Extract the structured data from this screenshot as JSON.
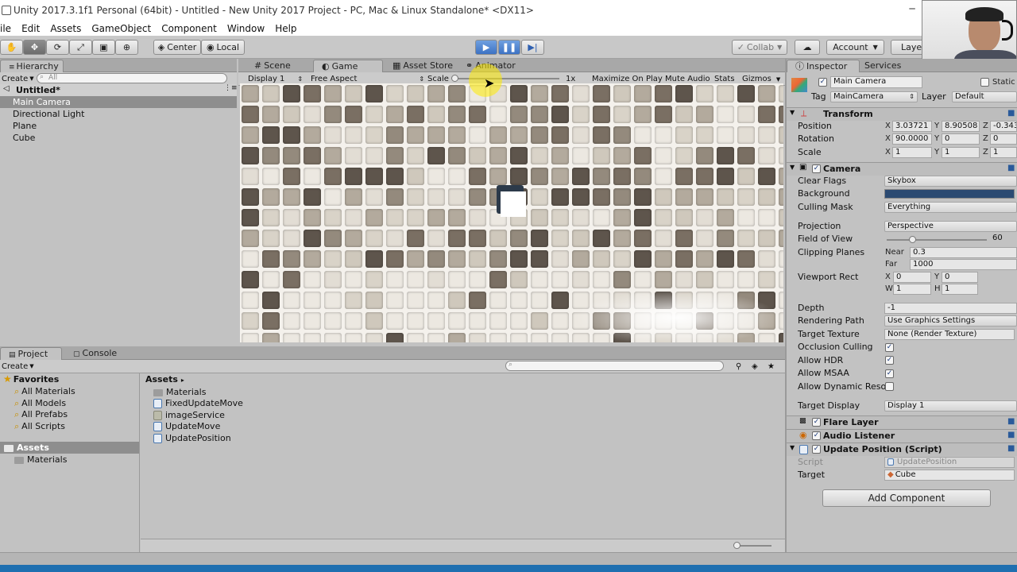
{
  "window": {
    "title": "Unity 2017.3.1f1 Personal (64bit) - Untitled - New Unity 2017 Project - PC, Mac & Linux Standalone* <DX11>"
  },
  "menu": [
    "ile",
    "Edit",
    "Assets",
    "GameObject",
    "Component",
    "Window",
    "Help"
  ],
  "toolbar": {
    "center_label": "Center",
    "local_label": "Local",
    "collab_label": "Collab",
    "account_label": "Account",
    "layers_label": "Laye"
  },
  "hierarchy": {
    "tab": "Hierarchy",
    "create": "Create",
    "search_placeholder": "All",
    "scene": "Untitled*",
    "items": [
      "Main Camera",
      "Directional Light",
      "Plane",
      "Cube"
    ]
  },
  "center_tabs": [
    "Scene",
    "Game",
    "Asset Store",
    "Animator"
  ],
  "game_bar": {
    "display": "Display 1",
    "aspect": "Free Aspect",
    "scale_label": "Scale",
    "scale_value": "1x",
    "maximize": "Maximize On Play",
    "mute": "Mute Audio",
    "stats": "Stats",
    "gizmos": "Gizmos"
  },
  "project": {
    "tab": "Project",
    "console_tab": "Console",
    "create": "Create",
    "favorites_label": "Favorites",
    "favorites": [
      "All Materials",
      "All Models",
      "All Prefabs",
      "All Scripts"
    ],
    "assets_root": "Assets",
    "assets_children": [
      "Materials"
    ],
    "breadcrumb": "Assets",
    "files": [
      {
        "name": "Materials",
        "kind": "folder"
      },
      {
        "name": "FixedUpdateMove",
        "kind": "script"
      },
      {
        "name": "imageService",
        "kind": "image"
      },
      {
        "name": "UpdateMove",
        "kind": "script"
      },
      {
        "name": "UpdatePosition",
        "kind": "script"
      }
    ]
  },
  "inspector": {
    "tab": "Inspector",
    "services_tab": "Services",
    "object_name": "Main Camera",
    "static_label": "Static",
    "tag_label": "Tag",
    "tag_value": "MainCamera",
    "layer_label": "Layer",
    "layer_value": "Default",
    "transform": {
      "title": "Transform",
      "position_label": "Position",
      "position": {
        "x": "3.03721",
        "y": "8.90508",
        "z": "-0.343"
      },
      "rotation_label": "Rotation",
      "rotation": {
        "x": "90.0000",
        "y": "0",
        "z": "0"
      },
      "scale_label": "Scale",
      "scale": {
        "x": "1",
        "y": "1",
        "z": "1"
      }
    },
    "camera": {
      "title": "Camera",
      "clear_flags_label": "Clear Flags",
      "clear_flags": "Skybox",
      "background_label": "Background",
      "background_color": "#2b4a72",
      "culling_mask_label": "Culling Mask",
      "culling_mask": "Everything",
      "projection_label": "Projection",
      "projection": "Perspective",
      "fov_label": "Field of View",
      "fov": "60",
      "fov_fraction": 0.25,
      "clipping_label": "Clipping Planes",
      "near_label": "Near",
      "near": "0.3",
      "far_label": "Far",
      "far": "1000",
      "viewport_label": "Viewport Rect",
      "vp_x": "0",
      "vp_y": "0",
      "vp_w": "1",
      "vp_h": "1",
      "depth_label": "Depth",
      "depth": "-1",
      "rendering_path_label": "Rendering Path",
      "rendering_path": "Use Graphics Settings",
      "target_texture_label": "Target Texture",
      "target_texture": "None (Render Texture)",
      "occlusion_label": "Occlusion Culling",
      "hdr_label": "Allow HDR",
      "msaa_label": "Allow MSAA",
      "dynres_label": "Allow Dynamic Reso",
      "target_display_label": "Target Display",
      "target_display": "Display 1"
    },
    "flare_layer": "Flare Layer",
    "audio_listener": "Audio Listener",
    "update_position": {
      "title": "Update Position (Script)",
      "script_label": "Script",
      "script_value": "UpdatePosition",
      "target_label": "Target",
      "target_value": "Cube"
    },
    "add_component": "Add Component"
  },
  "axis": {
    "x": "X",
    "y": "Y",
    "z": "Z",
    "w": "W",
    "h": "H"
  }
}
